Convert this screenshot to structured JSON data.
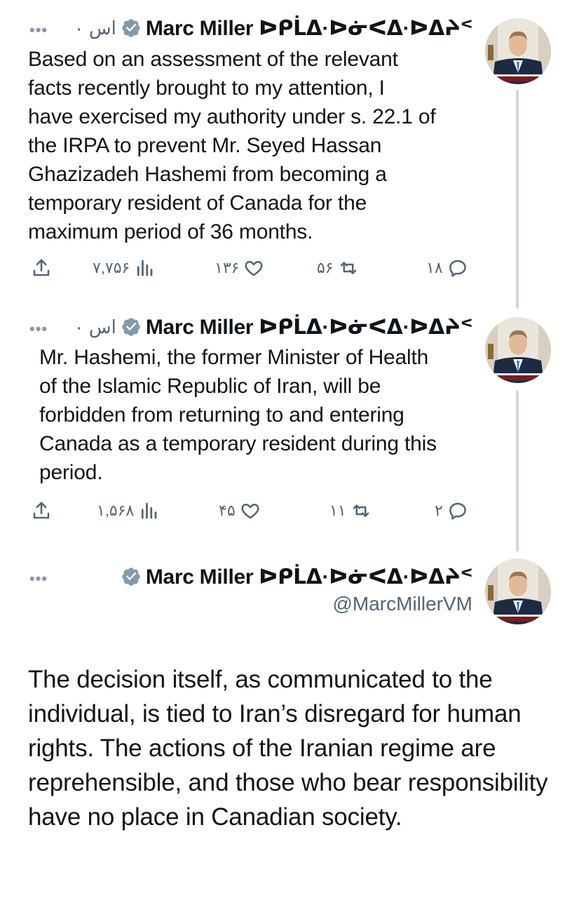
{
  "tweets": [
    {
      "name": "Marc Miller ᐅᑭᒫᐃ·ᐅᓃᐸᐃ·ᐅᐃᔨᑉ",
      "time": "۰ اس",
      "text": "Based on an assessment of the relevant\nfacts recently brought to my attention, I\nhave exercised my authority under s. 22.1 of\nthe IRPA to prevent Mr. Seyed Hassan\nGhazizadeh Hashemi from becoming a\ntemporary resident of Canada for the\nmaximum period of 36 months.",
      "views": "۷,۷۵۶",
      "likes": "۱۳۶",
      "reposts": "۵۶",
      "replies": "۱۸"
    },
    {
      "name": "Marc Miller ᐅᑭᒫᐃ·ᐅᓃᐸᐃ·ᐅᐃᔨᑉ",
      "time": "۰ اس",
      "text": "Mr. Hashemi, the former Minister of Health\nof the Islamic Republic of Iran, will be\nforbidden from returning to and entering\nCanada as a temporary resident during this\nperiod.",
      "views": "۱,۵۶۸",
      "likes": "۴۵",
      "reposts": "۱۱",
      "replies": "۲"
    }
  ],
  "main_tweet": {
    "name": "Marc Miller ᐅᑭᒫᐃ·ᐅᓃᐸᐃ·ᐅᐃᔨᑉ",
    "handle": "@MarcMillerVM",
    "text": "The decision itself, as communicated to the individual, is tied to Iran’s disregard for human rights. The actions of the Iranian regime are reprehensible, and those who bear responsibility have no place in Canadian society."
  },
  "more_label": "•••",
  "colors": {
    "text": "#0f1419",
    "secondary": "#536471",
    "verified": "#829aab",
    "thread": "#cfd9de"
  }
}
